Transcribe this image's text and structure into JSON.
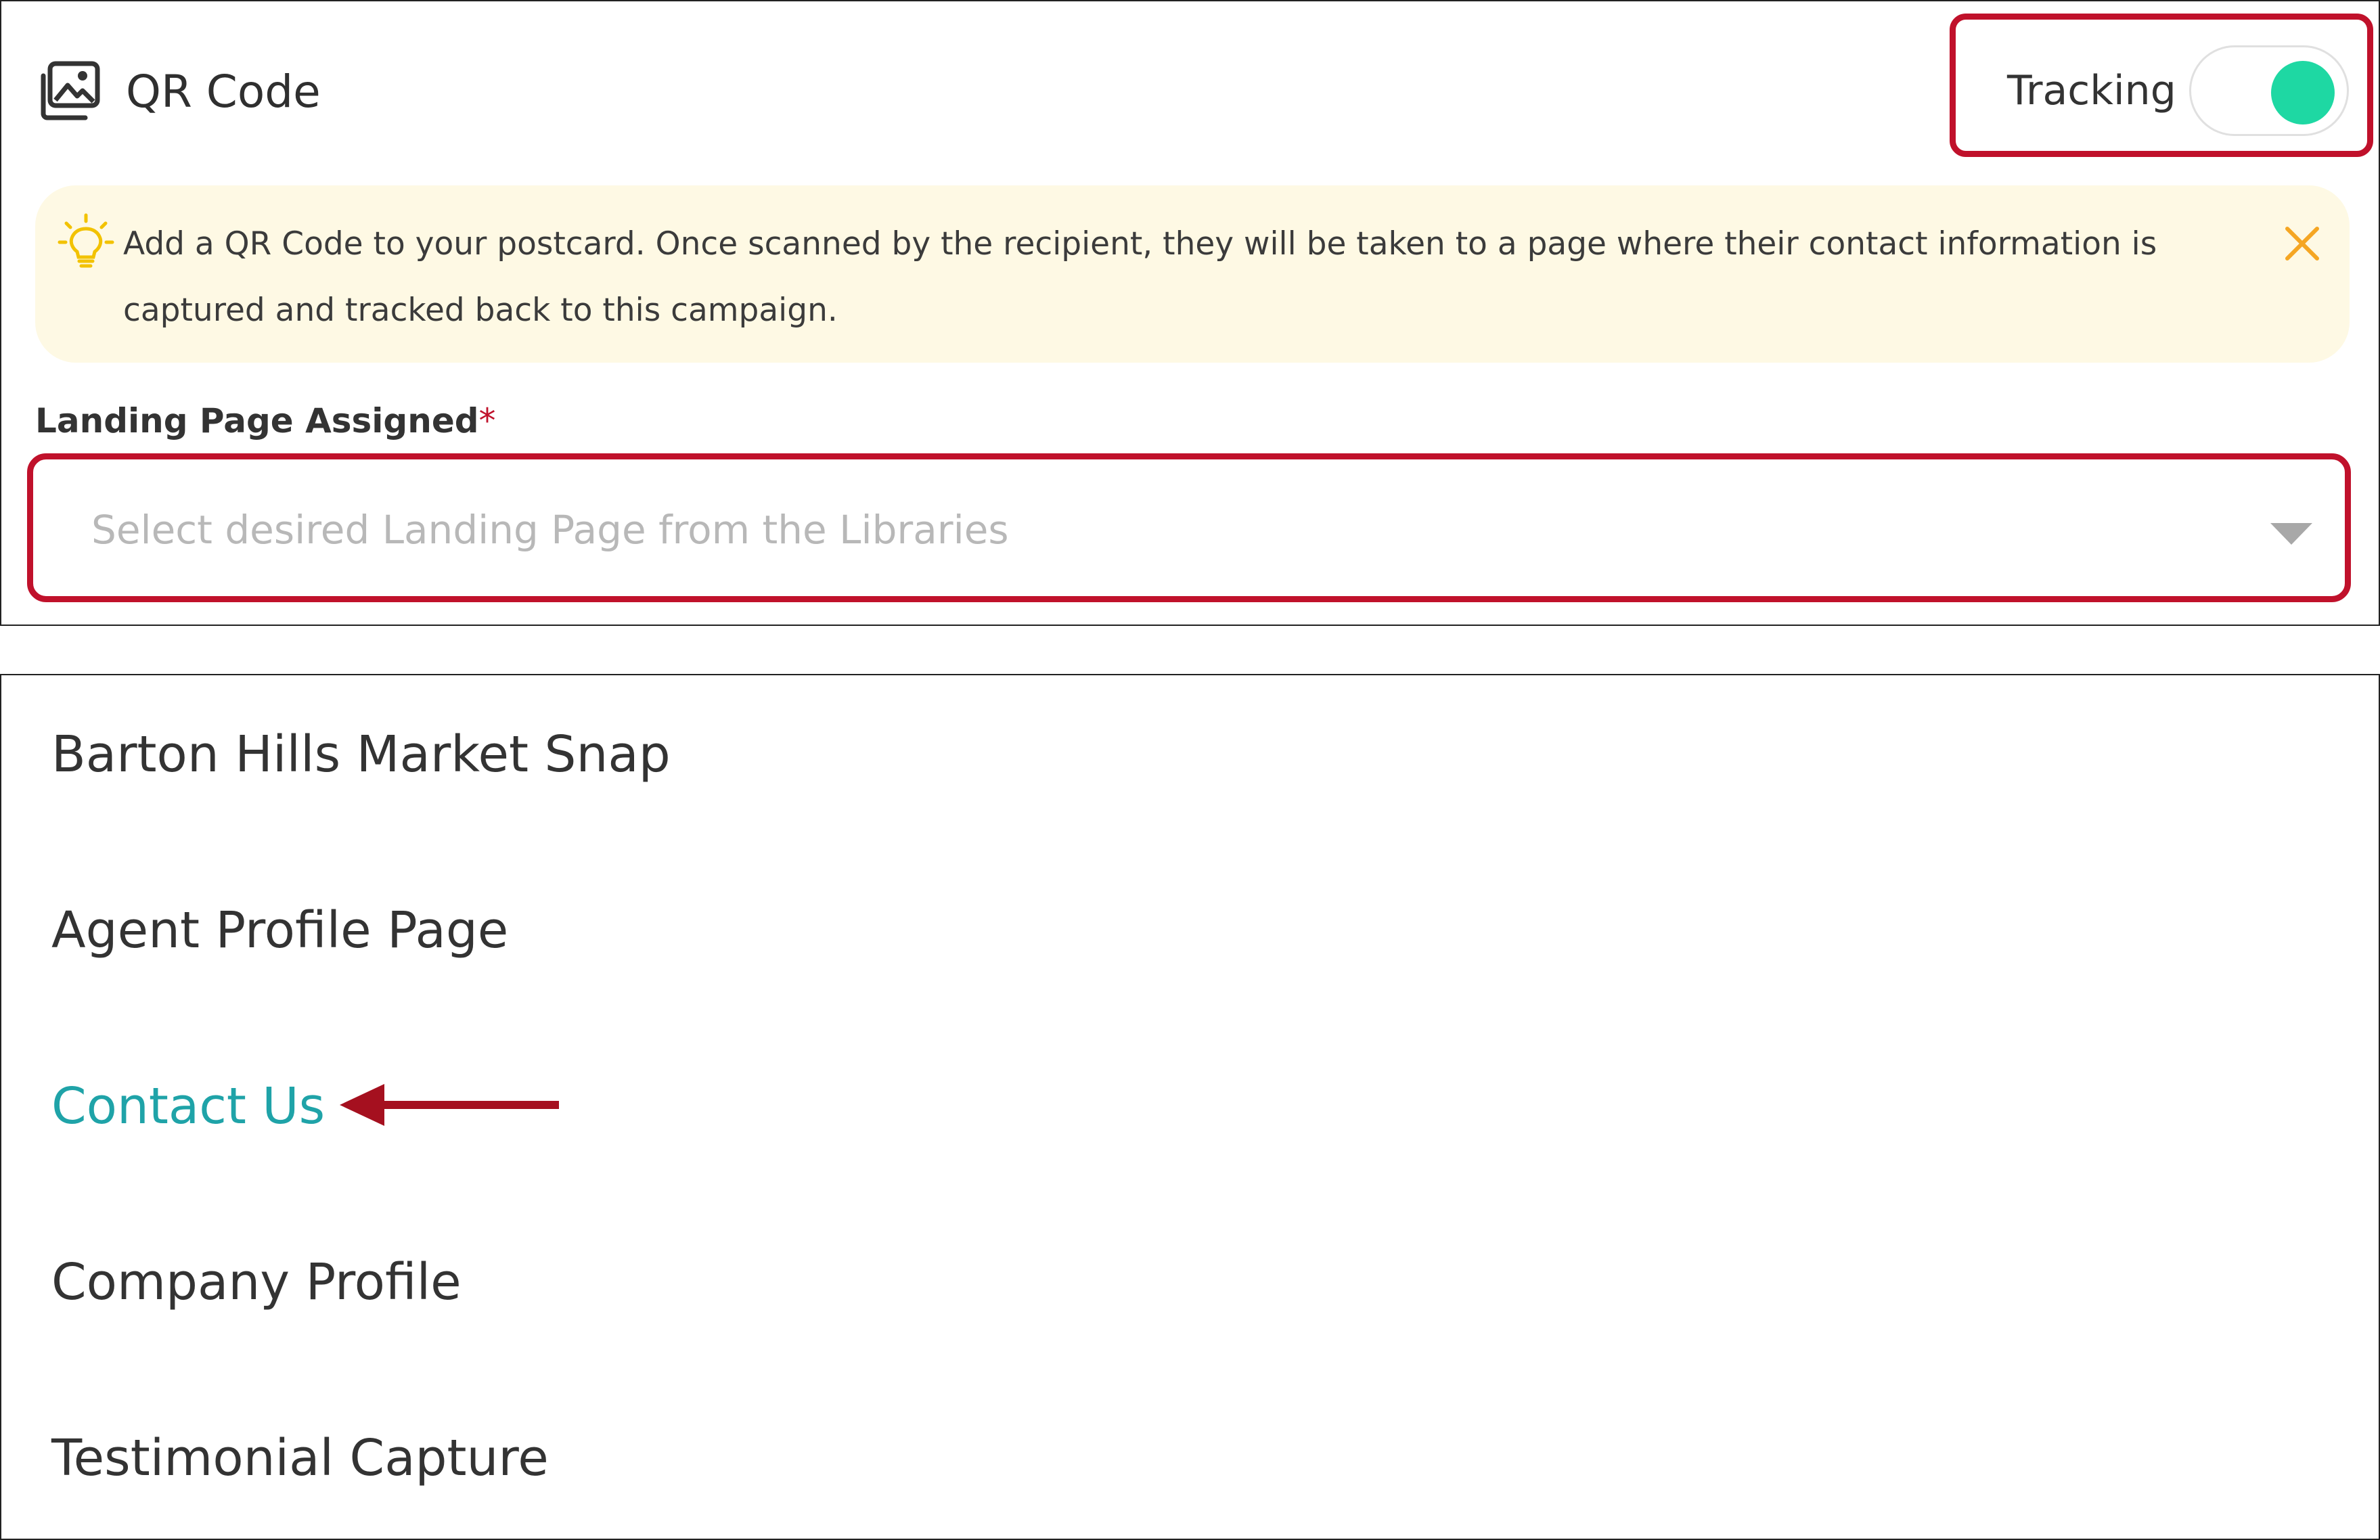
{
  "header": {
    "icon": "image-icon",
    "title": "QR Code",
    "tracking_label": "Tracking",
    "tracking_on": true
  },
  "banner": {
    "icon": "lightbulb-icon",
    "text": "Add a QR Code to your postcard. Once scanned by the recipient, they will be taken to a page where their contact information is captured and tracked back to this campaign.",
    "close_icon": "close-icon"
  },
  "field": {
    "label": "Landing Page Assigned",
    "required_mark": "*",
    "placeholder": "Select desired Landing Page from the Libraries",
    "arrow_icon": "caret-down-icon"
  },
  "options": [
    {
      "label": "Barton Hills Market Snap",
      "active": false
    },
    {
      "label": "Agent Profile Page",
      "active": false
    },
    {
      "label": "Contact Us",
      "active": true
    },
    {
      "label": "Company Profile",
      "active": false
    },
    {
      "label": "Testimonial Capture",
      "active": false
    }
  ],
  "colors": {
    "highlight_red": "#c0112b",
    "toggle_on": "#1ed8a3",
    "banner_bg": "#fef9e4",
    "active_option": "#1fa3a8",
    "annotation_arrow": "#a5101f"
  }
}
